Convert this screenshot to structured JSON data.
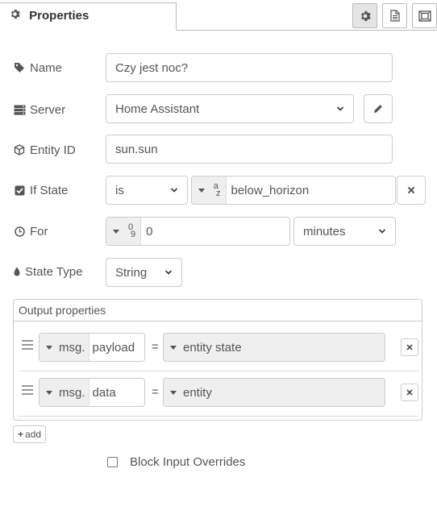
{
  "tabs": {
    "properties_label": "Properties",
    "icons": [
      "gear-icon",
      "file-icon",
      "frame-icon"
    ]
  },
  "form": {
    "name": {
      "label": "Name",
      "value": "Czy jest noc?"
    },
    "server": {
      "label": "Server",
      "value": "Home Assistant"
    },
    "entity_id": {
      "label": "Entity ID",
      "value": "sun.sun"
    },
    "if_state": {
      "label": "If State",
      "operator": "is",
      "type_glyph_top": "a",
      "type_glyph_bottom": "z",
      "value": "below_horizon"
    },
    "for": {
      "label": "For",
      "type_glyph_top": "0",
      "type_glyph_bottom": "9",
      "value": "0",
      "unit": "minutes"
    },
    "state_type": {
      "label": "State Type",
      "value": "String"
    }
  },
  "output": {
    "title": "Output properties",
    "rows": [
      {
        "prefix": "msg.",
        "field": "payload",
        "equals": "=",
        "value": "entity state"
      },
      {
        "prefix": "msg.",
        "field": "data",
        "equals": "=",
        "value": "entity"
      }
    ],
    "add_label": "add",
    "add_icon": "+"
  },
  "block_input": {
    "label": "Block Input Overrides",
    "checked": false
  },
  "colors": {
    "border": "#cccccc",
    "text": "#555555",
    "grey_fill": "#efefef"
  }
}
